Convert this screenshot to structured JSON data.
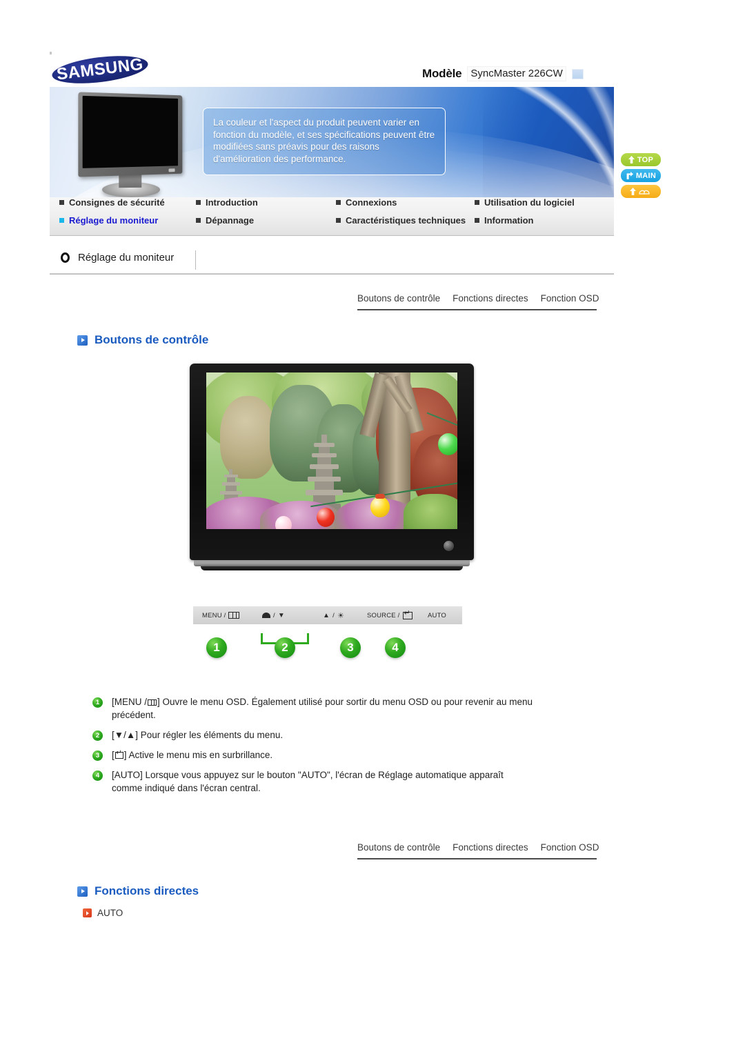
{
  "brand": {
    "logo_text": "SAMSUNG"
  },
  "model": {
    "label": "Modèle",
    "value": "SyncMaster 226CW"
  },
  "banner": {
    "notice": "La couleur et l'aspect du produit peuvent varier en fonction du modèle, et ses spécifications peuvent être modifiées sans préavis pour des raisons d'amélioration des performance."
  },
  "nav": {
    "row1": [
      {
        "label": "Consignes de sécurité",
        "active": false
      },
      {
        "label": "Introduction",
        "active": false
      },
      {
        "label": "Connexions",
        "active": false
      },
      {
        "label": "Utilisation du logiciel",
        "active": false
      }
    ],
    "row2": [
      {
        "label": "Réglage du moniteur",
        "active": true
      },
      {
        "label": "Dépannage",
        "active": false
      },
      {
        "label": "Caractéristiques techniques",
        "active": false
      },
      {
        "label": "Information",
        "active": false
      }
    ]
  },
  "side_buttons": [
    {
      "label": "TOP",
      "icon": "arrow-up-icon",
      "color": "#9ac72c"
    },
    {
      "label": "MAIN",
      "icon": "arrow-branch-icon",
      "color": "#17a2e0"
    },
    {
      "label": "",
      "icon": "arrow-up-book-icon",
      "color": "#f6ab17"
    }
  ],
  "section": {
    "title": "Réglage du moniteur"
  },
  "tabs_top": [
    {
      "label": "Boutons de contrôle"
    },
    {
      "label": "Fonctions directes"
    },
    {
      "label": "Fonction OSD"
    }
  ],
  "tabs_bottom": [
    {
      "label": "Boutons de contrôle"
    },
    {
      "label": "Fonctions directes"
    },
    {
      "label": "Fonction OSD"
    }
  ],
  "heading_control": "Boutons de contrôle",
  "heading_direct": "Fonctions directes",
  "control_bar": [
    {
      "id": "menu",
      "text_before": "MENU /",
      "glyph": "menu-box-glyph",
      "text_after": ""
    },
    {
      "id": "down",
      "text_before": "",
      "glyph": "contrast-down-glyph",
      "text_after": ""
    },
    {
      "id": "up",
      "text_before": "",
      "glyph": "up-brightness-glyph",
      "text_after": ""
    },
    {
      "id": "source",
      "text_before": "SOURCE /",
      "glyph": "enter-box-glyph",
      "text_after": ""
    },
    {
      "id": "auto",
      "text_before": "AUTO",
      "glyph": "",
      "text_after": ""
    }
  ],
  "callout_numbers": [
    "1",
    "2",
    "3",
    "4"
  ],
  "descriptions": [
    {
      "num": "1",
      "pre": "[MENU /",
      "glyph": "menu-box-glyph",
      "post": "] Ouvre le menu OSD. Également utilisé pour sortir du menu OSD ou pour revenir au menu précédent."
    },
    {
      "num": "2",
      "pre": "[▼/▲] Pour régler les éléments du menu.",
      "glyph": "",
      "post": ""
    },
    {
      "num": "3",
      "pre": "[",
      "glyph": "enter-box-glyph",
      "post": "] Active le menu mis en surbrillance."
    },
    {
      "num": "4",
      "pre": "[AUTO] Lorsque vous appuyez sur le bouton \"AUTO\", l'écran de Réglage automatique apparaît comme indiqué dans l'écran central.",
      "glyph": "",
      "post": ""
    }
  ],
  "direct_functions": [
    {
      "label": "AUTO"
    }
  ],
  "colors": {
    "accent_blue": "#1a5bbf",
    "nav_active": "#1a1ad0",
    "nav_active_bullet": "#19b7ea",
    "badge_green": "#2faa1f",
    "auto_red": "#d8371a",
    "top_green": "#9ac72c",
    "main_blue": "#17a2e0",
    "prev_orange": "#f6ab17"
  }
}
